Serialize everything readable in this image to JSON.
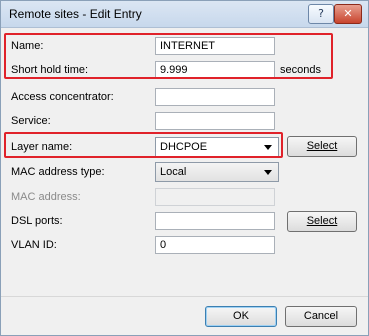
{
  "window": {
    "title": "Remote sites - Edit Entry",
    "help_label": "?",
    "close_label": "✕"
  },
  "fields": {
    "name": {
      "label": "Name:",
      "value": "INTERNET"
    },
    "short_hold": {
      "label": "Short hold time:",
      "value": "9.999",
      "unit": "seconds"
    },
    "access_concentrator": {
      "label": "Access concentrator:",
      "value": ""
    },
    "service": {
      "label": "Service:",
      "value": ""
    },
    "layer_name": {
      "label": "Layer name:",
      "value": "DHCPOE",
      "button": "Select"
    },
    "mac_type": {
      "label": "MAC address type:",
      "value": "Local"
    },
    "mac_address": {
      "label": "MAC address:",
      "value": ""
    },
    "dsl_ports": {
      "label": "DSL ports:",
      "value": "",
      "button": "Select"
    },
    "vlan_id": {
      "label": "VLAN ID:",
      "value": "0"
    }
  },
  "footer": {
    "ok": "OK",
    "cancel": "Cancel"
  },
  "colors": {
    "highlight": "#e0222a",
    "titlebar": "#c7d8ec"
  }
}
